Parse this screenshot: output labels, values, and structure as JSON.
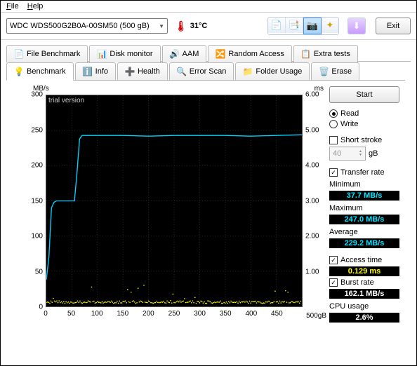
{
  "menu": {
    "file": "File",
    "help": "Help"
  },
  "toolbar": {
    "device": "WDC  WDS500G2B0A-00SM50 (500 gB)",
    "temp": "31°C",
    "exit": "Exit"
  },
  "tabs_row1": [
    {
      "icon": "📄",
      "label": "File Benchmark"
    },
    {
      "icon": "📊",
      "label": "Disk monitor"
    },
    {
      "icon": "🔊",
      "label": "AAM"
    },
    {
      "icon": "🔀",
      "label": "Random Access"
    },
    {
      "icon": "📋",
      "label": "Extra tests"
    }
  ],
  "tabs_row2": [
    {
      "icon": "💡",
      "label": "Benchmark",
      "active": true
    },
    {
      "icon": "ℹ️",
      "label": "Info"
    },
    {
      "icon": "➕",
      "label": "Health"
    },
    {
      "icon": "🔍",
      "label": "Error Scan"
    },
    {
      "icon": "📁",
      "label": "Folder Usage"
    },
    {
      "icon": "🗑️",
      "label": "Erase"
    }
  ],
  "side": {
    "start": "Start",
    "read": "Read",
    "write": "Write",
    "short_stroke": "Short stroke",
    "short_val": "40",
    "gb": "gB",
    "transfer_rate": "Transfer rate",
    "minimum": "Minimum",
    "min_val": "37.7 MB/s",
    "maximum": "Maximum",
    "max_val": "247.0 MB/s",
    "average": "Average",
    "avg_val": "229.2 MB/s",
    "access_time": "Access time",
    "acc_val": "0.129 ms",
    "burst_rate": "Burst rate",
    "burst_val": "162.1 MB/s",
    "cpu_usage": "CPU usage",
    "cpu_val": "2.6%"
  },
  "chart_axes": {
    "y_label": "MB/s",
    "y2_label": "ms",
    "y_ticks": [
      "300",
      "250",
      "200",
      "150",
      "100",
      "50",
      "0"
    ],
    "y2_ticks": [
      "6.00",
      "5.00",
      "4.00",
      "3.00",
      "2.00",
      "1.00"
    ],
    "x_ticks": [
      "0",
      "50",
      "100",
      "150",
      "200",
      "250",
      "300",
      "350",
      "400",
      "450"
    ],
    "x_unit": "500gB",
    "watermark": "trial version"
  },
  "chart_data": {
    "type": "line",
    "title": "",
    "xlabel": "gB",
    "ylabel": "MB/s",
    "y2label": "ms",
    "xlim": [
      0,
      500
    ],
    "ylim": [
      0,
      300
    ],
    "y2lim": [
      0,
      6
    ],
    "series": [
      {
        "name": "Transfer rate",
        "axis": "y",
        "color": "#00d4ff",
        "x": [
          0,
          5,
          10,
          15,
          20,
          25,
          30,
          40,
          50,
          55,
          60,
          65,
          70,
          80,
          100,
          150,
          200,
          250,
          300,
          350,
          400,
          450,
          500
        ],
        "values": [
          38,
          70,
          140,
          148,
          150,
          150,
          150,
          150,
          150,
          150,
          190,
          238,
          243,
          243,
          243,
          243,
          242,
          243,
          243,
          243,
          242,
          243,
          244
        ]
      },
      {
        "name": "Access time",
        "axis": "y2",
        "color": "#ffff00",
        "style": "scatter",
        "note": "dense dots ~0.1–0.2 ms across full range 0–500 gB"
      }
    ]
  }
}
